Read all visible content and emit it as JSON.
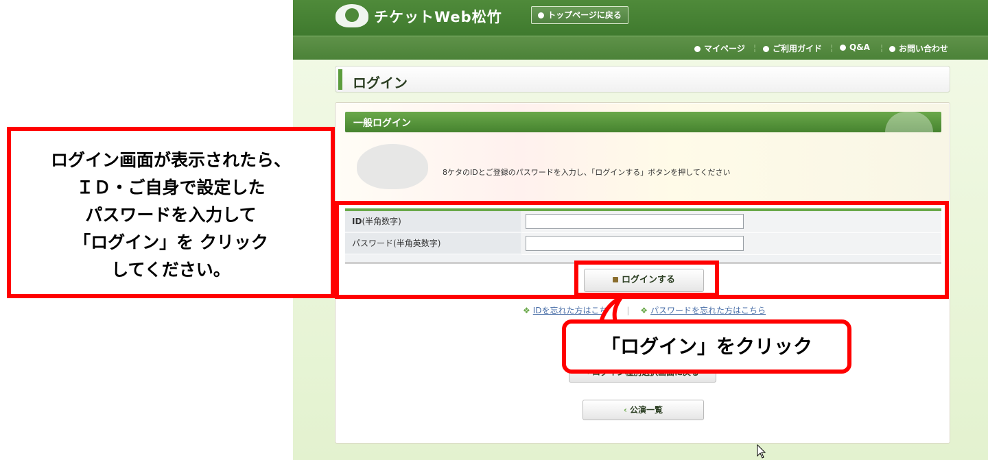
{
  "header": {
    "logo_text": "チケットWeb松竹",
    "top_page_button": "トップページに戻る",
    "nav": [
      "マイページ",
      "ご利用ガイド",
      "Q&A",
      "お問い合わせ"
    ]
  },
  "page": {
    "title": "ログイン",
    "section_title": "一般ログイン",
    "instructions": "8ケタのIDとご登録のパスワードを入力し、「ログインする」ボタンを押してください",
    "form": {
      "id_label": "ID",
      "id_hint": "(半角数字)",
      "password_label": "パスワード",
      "password_hint": "(半角英数字)",
      "id_value": "",
      "password_value": ""
    },
    "login_button": "ログインする",
    "forgot_id_link": "IDを忘れた方はこちら",
    "forgot_password_link": "パスワードを忘れた方はこちら",
    "back_button": "ログイン種別選択画面に戻る",
    "list_button": "公演一覧"
  },
  "annotations": {
    "note_lines": [
      "ログイン画面が表示されたら、",
      "ＩＤ・ご自身で設定した",
      "パスワードを入力して",
      "「ログイン」を クリック",
      "してください。"
    ],
    "callout": "「ログイン」をクリック"
  },
  "colors": {
    "brand_green": "#4f8a3a",
    "annotation_red": "#ff0000",
    "link_blue": "#4a6fa8"
  }
}
